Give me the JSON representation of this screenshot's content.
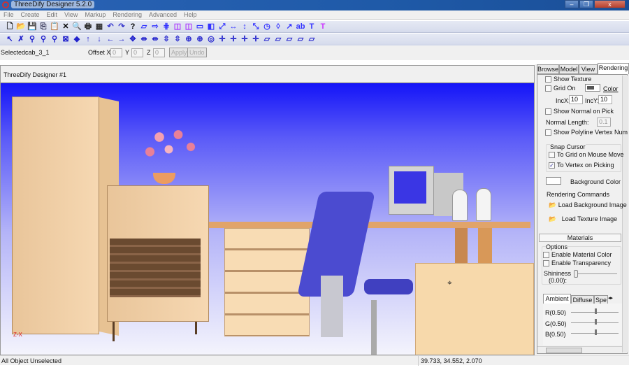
{
  "window": {
    "title": "ThreeDify Designer 5.2.0",
    "min": "–",
    "max": "❐",
    "close": "x"
  },
  "menu": [
    "File",
    "Create",
    "Edit",
    "View",
    "Markup",
    "Rendering",
    "Advanced",
    "Help"
  ],
  "toolbar1": [
    "new-icon",
    "open-icon",
    "save-icon",
    "copy-icon",
    "paste-icon",
    "delete-icon",
    "print-preview-icon",
    "print-icon",
    "properties-icon",
    "undo-icon",
    "redo-icon",
    "help-pointer-icon",
    "box-icon",
    "extrude-icon",
    "array-icon",
    "boolean-icon",
    "union-icon",
    "slab-icon",
    "wall-icon",
    "move-icon",
    "dimension-icon",
    "height-icon",
    "scale-icon",
    "rotate-icon",
    "mirror-icon",
    "stretch-icon",
    "text-ab-icon",
    "text-icon",
    "text-3d-icon"
  ],
  "toolbar1_glyphs": [
    "🗋",
    "📂",
    "💾",
    "⎘",
    "📋",
    "✕",
    "🔍",
    "🖶",
    "▦",
    "↶",
    "↷",
    "?",
    "▱",
    "⇨",
    "⋕",
    "◫",
    "◫",
    "▭",
    "◧",
    "⤢",
    "↔",
    "↕",
    "⤡",
    "◷",
    "◊",
    "↗",
    "ab",
    "T",
    "T"
  ],
  "toolbar2": [
    "select-icon",
    "deselect-icon",
    "zoom-icon",
    "zoom-in-icon",
    "zoom-out-icon",
    "zoom-reset-icon",
    "center-icon",
    "pan-up-icon",
    "pan-down-icon",
    "pan-left-icon",
    "pan-right-icon",
    "move-all-icon",
    "rotate-x-icon",
    "rotate-y-icon",
    "rotate-z-icon",
    "tilt-icon",
    "orbit-icon",
    "orbit-plus-icon",
    "orbit-target-icon",
    "axis-1-icon",
    "axis-2-icon",
    "axis-3-icon",
    "axis-4-icon",
    "view-front-icon",
    "view-side-icon",
    "view-top-icon",
    "view-back-icon",
    "view-iso-icon"
  ],
  "toolbar2_glyphs": [
    "↖",
    "✗",
    "⚲",
    "⚲",
    "⚲",
    "⊠",
    "◆",
    "↑",
    "↓",
    "←",
    "→",
    "✥",
    "⇹",
    "⇹",
    "⇳",
    "⇳",
    "⊕",
    "⊕",
    "◎",
    "✛",
    "✛",
    "✛",
    "✛",
    "▱",
    "▱",
    "▱",
    "▱",
    "▱"
  ],
  "selection": {
    "label": "Selected:",
    "value": "cab_3_1",
    "offset_label": "Offset X",
    "x": "0",
    "y_label": "Y",
    "y": "0",
    "z_label": "Z",
    "z": "0",
    "apply": "Apply",
    "undo": "Undo"
  },
  "document": {
    "title": "ThreeDify Designer #1"
  },
  "status": {
    "left": "All Object Unselected",
    "coords": "39.733, 34.552, 2.070"
  },
  "panel": {
    "tabs": [
      "Browse",
      "Model",
      "View",
      "Rendering"
    ],
    "show_texture": "Show Texture",
    "grid_on": "Grid On",
    "color": "Color",
    "incx_label": "IncX:",
    "incx": "10",
    "incy_label": "IncY:",
    "incy": "10",
    "show_normal": "Show Normal on Pick",
    "normal_length_label": "Normal Length:",
    "normal_length": "0.1",
    "show_polyline": "Show Polyline Vertex Num",
    "snap_title": "Snap Cursor",
    "snap_grid": "To Grid on Mouse Move",
    "snap_vertex": "To Vertex on Picking",
    "background_color": "Background Color",
    "rendering_commands": "Rendering Commands",
    "load_bg": "Load Background Image",
    "load_tex": "Load Texture Image",
    "materials": "Materials",
    "options": "Options",
    "enable_color": "Enable Material Color",
    "enable_transparency": "Enable Transparency",
    "shininess_label": "Shininess",
    "shininess_value": "(0.00):",
    "shininess": 0,
    "mat_tabs": [
      "Ambient",
      "Diffuse",
      "Spe"
    ],
    "r": "R(0.50)",
    "g": "G(0.50)",
    "b": "B(0.50)",
    "rgb": [
      0.5,
      0.5,
      0.5
    ]
  },
  "colors": {
    "titlebar": "#2a63b5",
    "viewport_top": "#1414f8",
    "wood": "#f6d8b2"
  }
}
